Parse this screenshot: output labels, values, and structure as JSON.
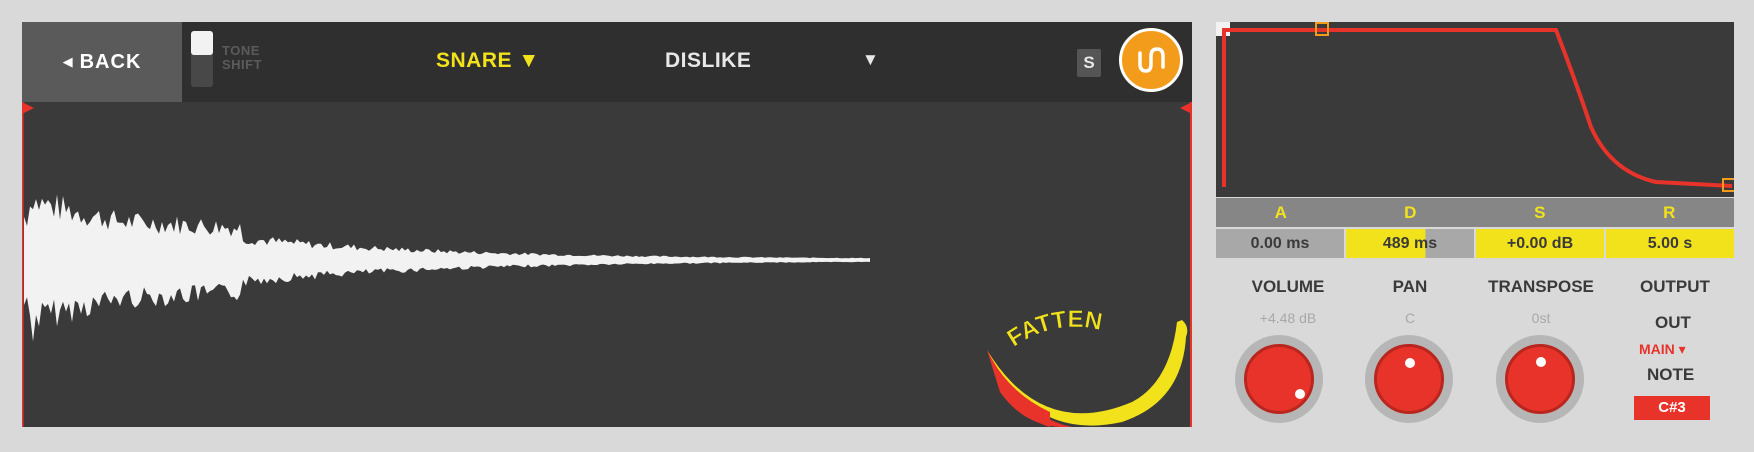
{
  "topbar": {
    "back_label": "BACK",
    "tone_shift": [
      "TONE",
      "SHIFT"
    ],
    "instrument": "SNARE ▼",
    "preset": "DISLIKE",
    "preset_arrow": "▼",
    "solo_label": "S",
    "logo_icon": "logo-icon"
  },
  "waveform": {
    "fatten_label": "FATTEN",
    "fatten_icon": "banana-icon"
  },
  "envelope": {
    "headers": [
      "A",
      "D",
      "S",
      "R"
    ],
    "values": [
      "0.00 ms",
      "489 ms",
      "+0.00 dB",
      "5.00 s"
    ]
  },
  "controls": {
    "volume": {
      "label": "VOLUME",
      "value": "+4.48 dB"
    },
    "pan": {
      "label": "PAN",
      "value": "C"
    },
    "transpose": {
      "label": "TRANSPOSE",
      "value": "0st"
    },
    "output": {
      "label": "OUTPUT",
      "out_label": "OUT",
      "main": "MAIN ▾",
      "note_label": "NOTE",
      "note": "C#3"
    }
  },
  "colors": {
    "accent_yellow": "#f2e21c",
    "accent_red": "#e8332a",
    "panel": "#3a3a3a",
    "orange": "#f39c1c"
  }
}
